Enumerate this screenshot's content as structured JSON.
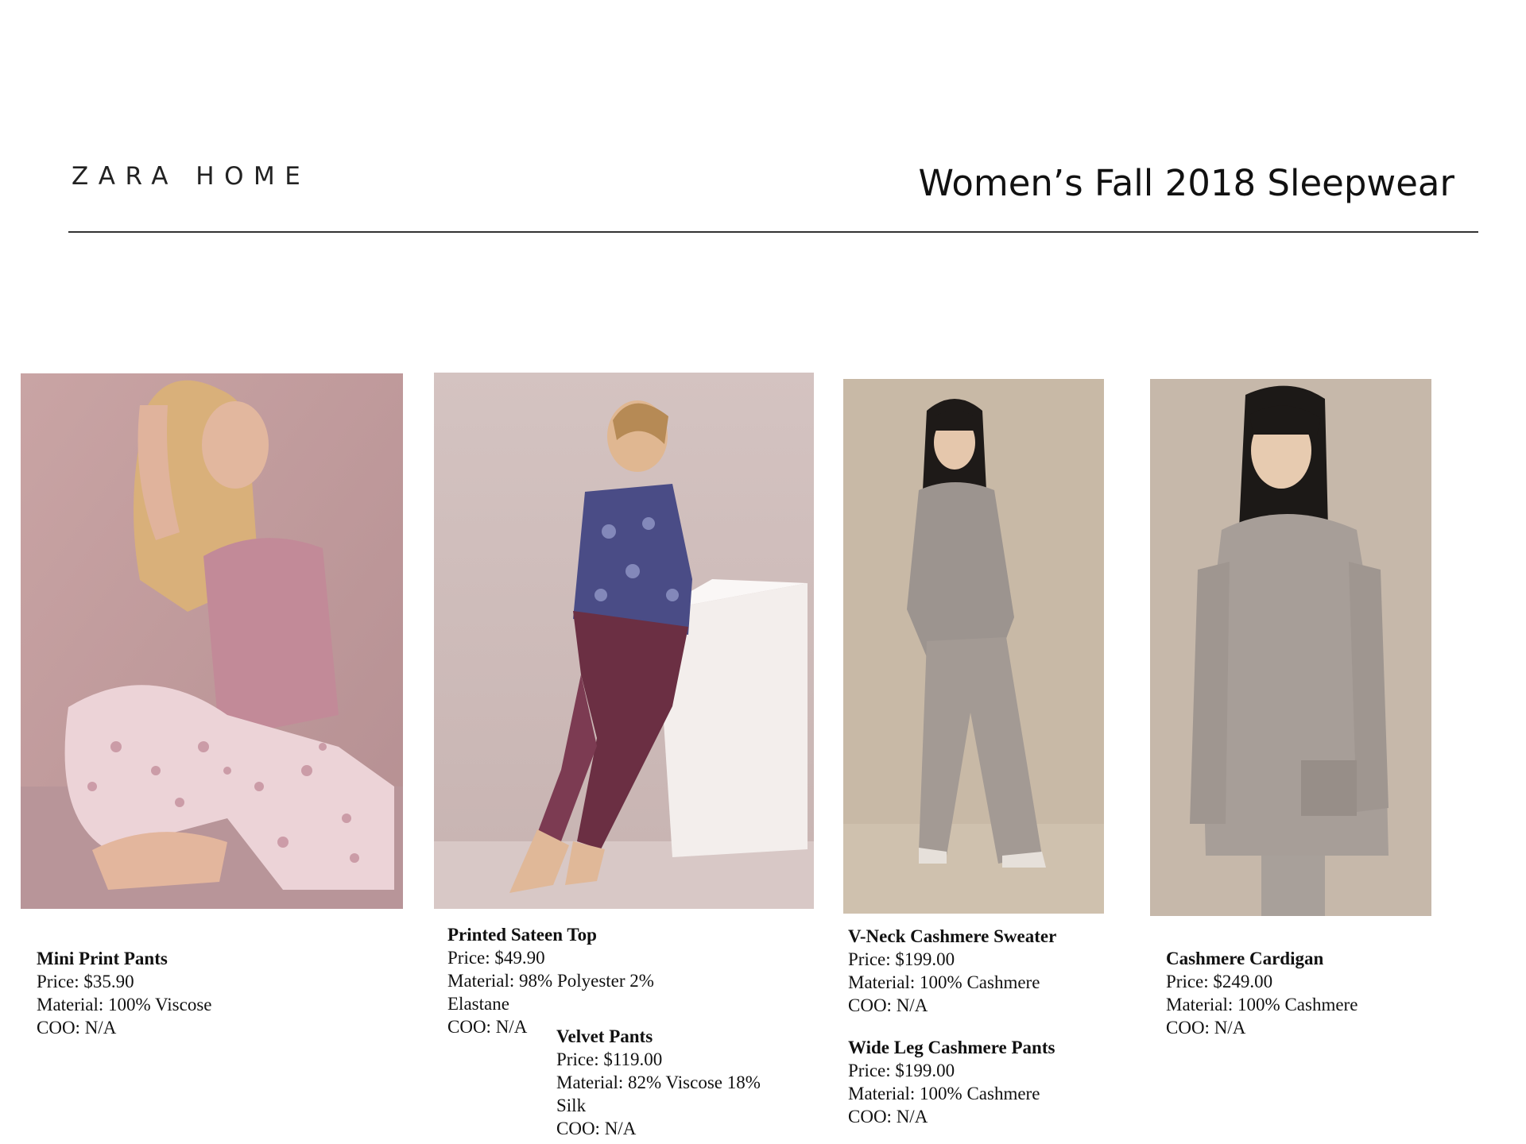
{
  "header": {
    "brand": "ZARA HOME",
    "title": "Women’s Fall 2018 Sleepwear"
  },
  "photos": [
    {
      "alt": "Model seated in pink tee and floral print pants"
    },
    {
      "alt": "Model in printed sateen top and velvet pants leaning on a white block"
    },
    {
      "alt": "Model in grey cashmere sweater and wide leg pants"
    },
    {
      "alt": "Model in grey cashmere cardigan"
    }
  ],
  "products": [
    {
      "name": "Mini Print Pants",
      "price": "Price: $35.90",
      "material": "Material: 100% Viscose",
      "coo": "COO: N/A"
    },
    {
      "name": "Printed Sateen Top",
      "price": "Price: $49.90",
      "material": "Material: 98% Polyester 2%",
      "material2": "Elastane",
      "coo": "COO: N/A"
    },
    {
      "name": "Velvet Pants",
      "price": "Price: $119.00",
      "material": "Material: 82% Viscose 18%",
      "material2": "Silk",
      "coo": "COO: N/A"
    },
    {
      "name": "V-Neck Cashmere Sweater",
      "price": "Price: $199.00",
      "material": "Material: 100% Cashmere",
      "coo": "COO: N/A"
    },
    {
      "name": "Wide Leg Cashmere Pants",
      "price": "Price: $199.00",
      "material": "Material: 100% Cashmere",
      "coo": "COO: N/A"
    },
    {
      "name": "Cashmere Cardigan",
      "price": "Price: $249.00",
      "material": "Material: 100% Cashmere",
      "coo": "COO: N/A"
    }
  ]
}
